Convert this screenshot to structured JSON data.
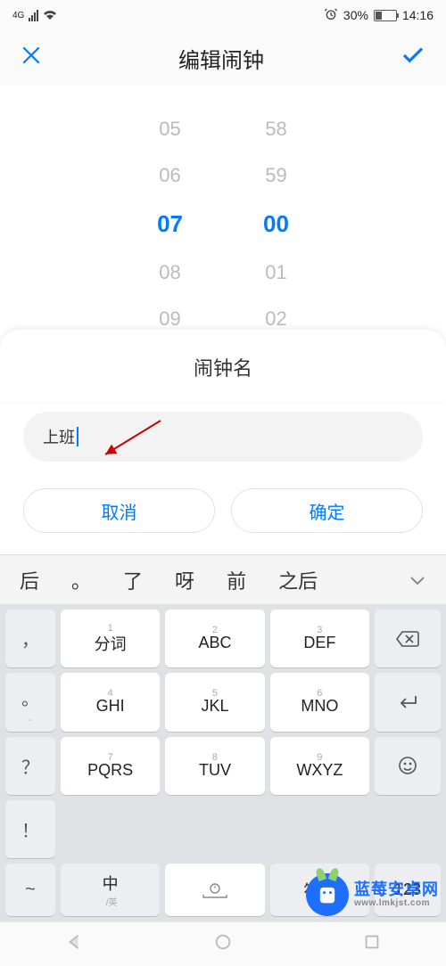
{
  "status": {
    "net": "4G",
    "battery": "30%",
    "time": "14:16"
  },
  "topbar": {
    "title": "编辑闹钟"
  },
  "picker": {
    "hours": [
      "05",
      "06",
      "07",
      "08",
      "09"
    ],
    "mins": [
      "58",
      "59",
      "00",
      "01",
      "02"
    ],
    "sel_idx": 2
  },
  "dialog": {
    "title": "闹钟名",
    "input_value": "上班",
    "cancel_label": "取消",
    "confirm_label": "确定"
  },
  "suggestions": [
    "后",
    "。",
    "了",
    "呀",
    "前",
    "之后"
  ],
  "keyboard": {
    "rows": [
      {
        "side": "，",
        "k": [
          {
            "n": "1",
            "t": "分词"
          },
          {
            "n": "2",
            "t": "ABC"
          },
          {
            "n": "3",
            "t": "DEF"
          }
        ],
        "action": "backspace"
      },
      {
        "side": "。",
        "sub": "-",
        "k": [
          {
            "n": "4",
            "t": "GHI"
          },
          {
            "n": "5",
            "t": "JKL"
          },
          {
            "n": "6",
            "t": "MNO"
          }
        ],
        "action": "enter"
      },
      {
        "side": "？",
        "k": [
          {
            "n": "7",
            "t": "PQRS"
          },
          {
            "n": "8",
            "t": "TUV"
          },
          {
            "n": "9",
            "t": "WXYZ"
          }
        ],
        "action": "emoji"
      },
      {
        "side": "！",
        "k": [],
        "action": ""
      }
    ],
    "bottom": {
      "side": "~",
      "lang": "中",
      "langsub": "/英",
      "space": "mic",
      "sym": "符号",
      "num": "123"
    }
  },
  "watermark": {
    "line1": "蓝莓安卓网",
    "line2": "www.lmkjst.com"
  }
}
